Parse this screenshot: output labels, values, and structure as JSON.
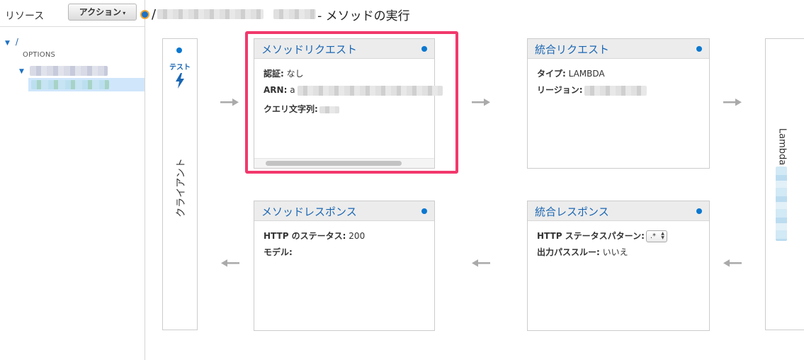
{
  "sidebar": {
    "title": "リソース",
    "actions_label": "アクション",
    "root": "/",
    "options_method": "OPTIONS"
  },
  "header": {
    "slash": "/",
    "title": "- メソッドの実行"
  },
  "client": {
    "test_label": "テスト",
    "label": "クライアント"
  },
  "method_request": {
    "title": "メソッドリクエスト",
    "auth_label": "認証:",
    "auth_value": "なし",
    "arn_label": "ARN:",
    "arn_prefix": "a",
    "query_label": "クエリ文字列:"
  },
  "integration_request": {
    "title": "統合リクエスト",
    "type_label": "タイプ:",
    "type_value": "LAMBDA",
    "region_label": "リージョン:"
  },
  "method_response": {
    "title": "メソッドレスポンス",
    "status_label": "HTTP のステータス:",
    "status_value": "200",
    "model_label": "モデル:"
  },
  "integration_response": {
    "title": "統合レスポンス",
    "pattern_label": "HTTP ステータスパターン:",
    "pattern_value": ".*",
    "passthrough_label": "出力パススルー:",
    "passthrough_value": "いいえ"
  },
  "lambda": {
    "label": "Lambda"
  },
  "colors": {
    "accent": "#1a66b3",
    "dot": "#0b78d0",
    "highlight": "#f2386c",
    "arrow": "#aaaaaa"
  }
}
